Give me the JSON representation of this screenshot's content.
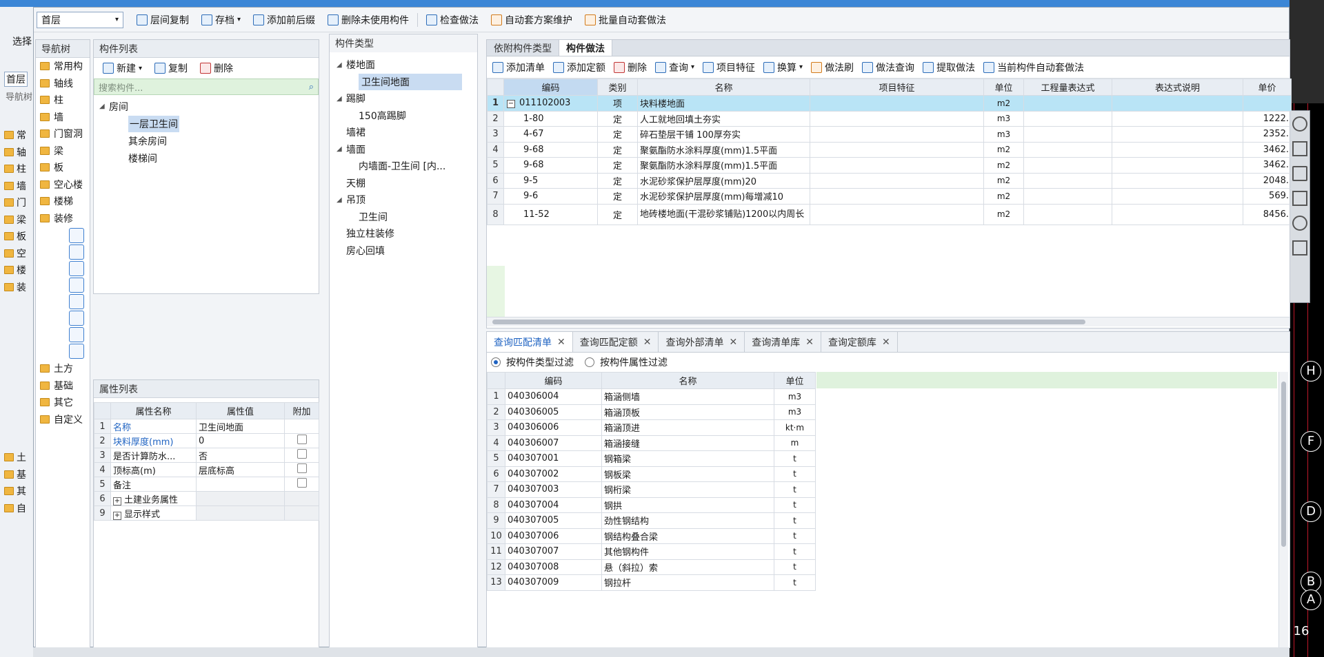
{
  "background": {
    "left_select_label": "选择",
    "left_floor": "首层",
    "left_nav_label": "导航树",
    "left_items": [
      "常",
      "轴",
      "柱",
      "墙",
      "门",
      "梁",
      "板",
      "空",
      "楼",
      "装"
    ],
    "left_items_bottom": [
      "土",
      "基",
      "其",
      "自"
    ],
    "axis_labels": [
      "H",
      "F",
      "D",
      "B",
      "A"
    ],
    "axis_number": "16"
  },
  "toolbar": {
    "floor": "首层",
    "buttons": [
      "层间复制",
      "存档",
      "添加前后缀",
      "删除未使用构件",
      "检查做法",
      "自动套方案维护",
      "批量自动套做法"
    ]
  },
  "nav_tree": {
    "title": "导航树",
    "items": [
      "常用构",
      "轴线",
      "柱",
      "墙",
      "门窗洞",
      "梁",
      "板",
      "空心楼",
      "楼梯",
      "装修"
    ],
    "items_bottom": [
      "土方",
      "基础",
      "其它",
      "自定义"
    ]
  },
  "component_list": {
    "title": "构件列表",
    "actions": [
      "新建",
      "复制",
      "删除"
    ],
    "search_placeholder": "搜索构件...",
    "root": "房间",
    "children": [
      "一层卫生间",
      "其余房间",
      "楼梯间"
    ]
  },
  "property_list": {
    "title": "属性列表",
    "headers": [
      "属性名称",
      "属性值",
      "附加"
    ],
    "rows": [
      {
        "no": "1",
        "name": "名称",
        "value": "卫生间地面"
      },
      {
        "no": "2",
        "name": "块料厚度(mm)",
        "value": "0"
      },
      {
        "no": "3",
        "name": "是否计算防水...",
        "value": "否"
      },
      {
        "no": "4",
        "name": "顶标高(m)",
        "value": "层底标高"
      },
      {
        "no": "5",
        "name": "备注",
        "value": ""
      },
      {
        "no": "6",
        "name": "土建业务属性",
        "value": ""
      },
      {
        "no": "9",
        "name": "显示样式",
        "value": ""
      }
    ]
  },
  "component_types": {
    "title": "构件类型",
    "items": [
      "楼地面",
      "卫生间地面",
      "踢脚",
      "150高踢脚",
      "墙裙",
      "墙面",
      "内墙面-卫生间 [内...",
      "天棚",
      "吊顶",
      "卫生间",
      "独立柱装修",
      "房心回填"
    ]
  },
  "method_tabs": [
    "依附构件类型",
    "构件做法"
  ],
  "method_toolbar": [
    "添加清单",
    "添加定额",
    "删除",
    "查询",
    "项目特征",
    "换算",
    "做法刷",
    "做法查询",
    "提取做法",
    "当前构件自动套做法"
  ],
  "method_table": {
    "headers": [
      "编码",
      "类别",
      "名称",
      "项目特征",
      "单位",
      "工程量表达式",
      "表达式说明",
      "单价"
    ],
    "rows": [
      {
        "no": "1",
        "code": "011102003",
        "type": "项",
        "name": "块料楼地面",
        "unit": "m2",
        "price": ""
      },
      {
        "no": "2",
        "code": "1-80",
        "type": "定",
        "name": "人工就地回填土夯实",
        "unit": "m3",
        "price": "1222."
      },
      {
        "no": "3",
        "code": "4-67",
        "type": "定",
        "name": "碎石垫层干铺 100厚夯实",
        "unit": "m3",
        "price": "2352."
      },
      {
        "no": "4",
        "code": "9-68",
        "type": "定",
        "name": "聚氨酯防水涂料厚度(mm)1.5平面",
        "unit": "m2",
        "price": "3462."
      },
      {
        "no": "5",
        "code": "9-68",
        "type": "定",
        "name": "聚氨酯防水涂料厚度(mm)1.5平面",
        "unit": "m2",
        "price": "3462."
      },
      {
        "no": "6",
        "code": "9-5",
        "type": "定",
        "name": "水泥砂浆保护层厚度(mm)20",
        "unit": "m2",
        "price": "2048."
      },
      {
        "no": "7",
        "code": "9-6",
        "type": "定",
        "name": "水泥砂浆保护层厚度(mm)每增减10",
        "unit": "m2",
        "price": "569."
      },
      {
        "no": "8",
        "code": "11-52",
        "type": "定",
        "name": "地砖楼地面(干混砂浆铺贴)1200以内周长",
        "unit": "m2",
        "price": "8456."
      }
    ]
  },
  "query_tabs": [
    "查询匹配清单",
    "查询匹配定额",
    "查询外部清单",
    "查询清单库",
    "查询定额库"
  ],
  "filters": {
    "by_type": "按构件类型过滤",
    "by_attr": "按构件属性过滤"
  },
  "query_table": {
    "headers": [
      "编码",
      "名称",
      "单位"
    ],
    "rows": [
      {
        "no": "1",
        "code": "040306004",
        "name": "箱涵侧墙",
        "unit": "m3"
      },
      {
        "no": "2",
        "code": "040306005",
        "name": "箱涵顶板",
        "unit": "m3"
      },
      {
        "no": "3",
        "code": "040306006",
        "name": "箱涵顶进",
        "unit": "kt·m"
      },
      {
        "no": "4",
        "code": "040306007",
        "name": "箱涵接缝",
        "unit": "m"
      },
      {
        "no": "5",
        "code": "040307001",
        "name": "钢箱梁",
        "unit": "t"
      },
      {
        "no": "6",
        "code": "040307002",
        "name": "钢板梁",
        "unit": "t"
      },
      {
        "no": "7",
        "code": "040307003",
        "name": "钢桁梁",
        "unit": "t"
      },
      {
        "no": "8",
        "code": "040307004",
        "name": "钢拱",
        "unit": "t"
      },
      {
        "no": "9",
        "code": "040307005",
        "name": "劲性钢结构",
        "unit": "t"
      },
      {
        "no": "10",
        "code": "040307006",
        "name": "钢结构叠合梁",
        "unit": "t"
      },
      {
        "no": "11",
        "code": "040307007",
        "name": "其他钢构件",
        "unit": "t"
      },
      {
        "no": "12",
        "code": "040307008",
        "name": "悬（斜拉）索",
        "unit": "t"
      },
      {
        "no": "13",
        "code": "040307009",
        "name": "钢拉杆",
        "unit": "t"
      }
    ]
  }
}
